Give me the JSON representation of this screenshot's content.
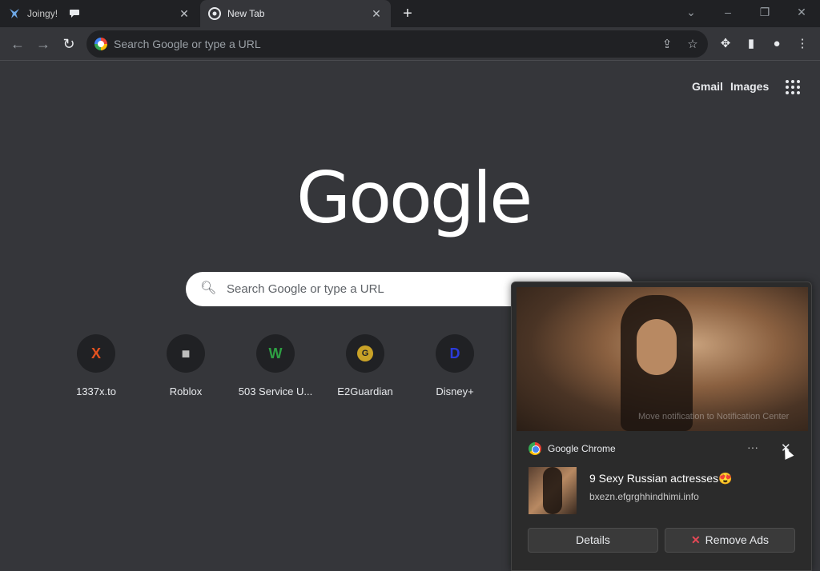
{
  "tabs": [
    {
      "title": "Joingy!",
      "active": false,
      "icon": "joingy-icon",
      "badge_icon": "speech-bubble-icon"
    },
    {
      "title": "New Tab",
      "active": true,
      "icon": "chrome-icon"
    }
  ],
  "omnibox": {
    "placeholder": "Search Google or type a URL"
  },
  "header_links": {
    "gmail": "Gmail",
    "images": "Images"
  },
  "logo": "Google",
  "search": {
    "placeholder": "Search Google or type a URL"
  },
  "shortcuts": [
    {
      "label": "1337x.to",
      "color": "#e4521f",
      "glyph": "X"
    },
    {
      "label": "Roblox",
      "color": "#bdbdbd",
      "glyph": "■"
    },
    {
      "label": "503 Service U...",
      "color": "#2ea043",
      "glyph": "W"
    },
    {
      "label": "E2Guardian",
      "color": "#c9a227",
      "glyph": "G"
    },
    {
      "label": "Disney+",
      "color": "#2b3bdb",
      "glyph": "D"
    }
  ],
  "notification": {
    "app_name": "Google Chrome",
    "more": "···",
    "title": "9 Sexy Russian actresses😍",
    "source": "bxezn.efgrghhindhimi.info",
    "image_overlay": "Move notification to Notification Center",
    "buttons": {
      "details": "Details",
      "remove": "Remove Ads",
      "remove_glyph": "✕"
    }
  },
  "colors": {
    "background": "#35363a",
    "tabstrip": "#202124",
    "accent_red": "#e74856"
  }
}
